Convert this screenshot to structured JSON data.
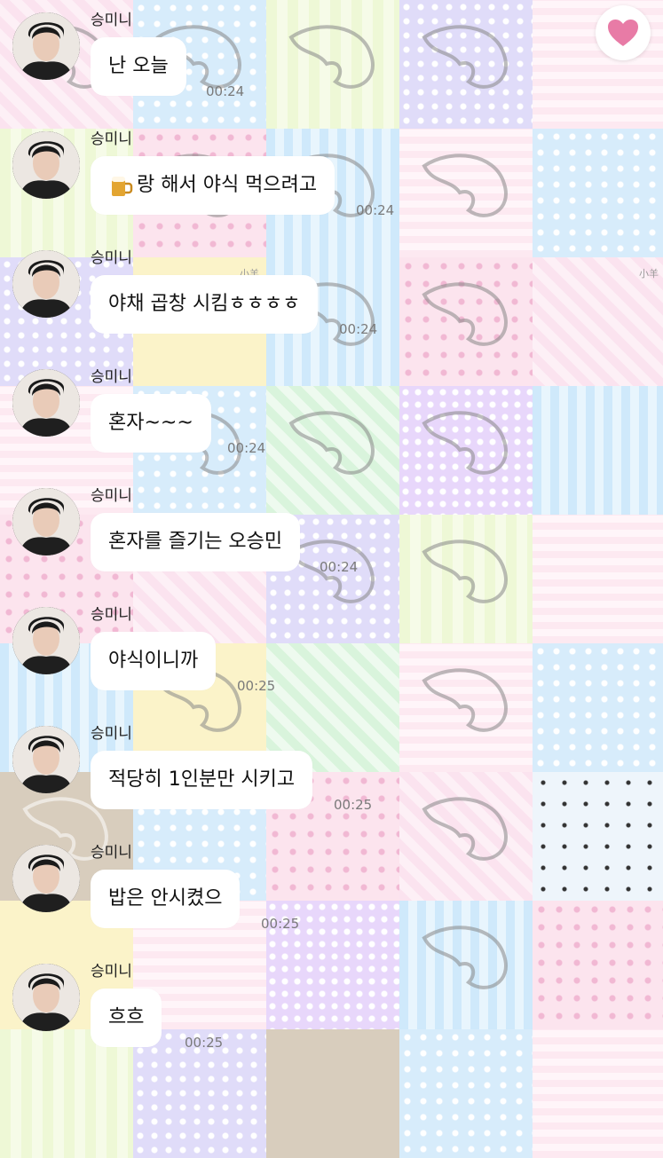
{
  "sender": "승미니",
  "background_tag": "小羊",
  "accent_heart_color": "#e87ba6",
  "messages": [
    {
      "text": "난 오늘",
      "time": "00:24"
    },
    {
      "text": "랑 해서 야식 먹으려고",
      "time": "00:24",
      "leading_icon": "beer-mug-icon"
    },
    {
      "text": "야채 곱창 시킴ㅎㅎㅎㅎ",
      "time": "00:24"
    },
    {
      "text": "혼자~~~",
      "time": "00:24"
    },
    {
      "text": "혼자를 즐기는 오승민",
      "time": "00:24"
    },
    {
      "text": "야식이니까",
      "time": "00:25"
    },
    {
      "text": "적당히 1인분만 시키고",
      "time": "00:25"
    },
    {
      "text": "밥은 안시켰으",
      "time": "00:25"
    },
    {
      "text": "흐흐",
      "time": "00:25"
    }
  ]
}
